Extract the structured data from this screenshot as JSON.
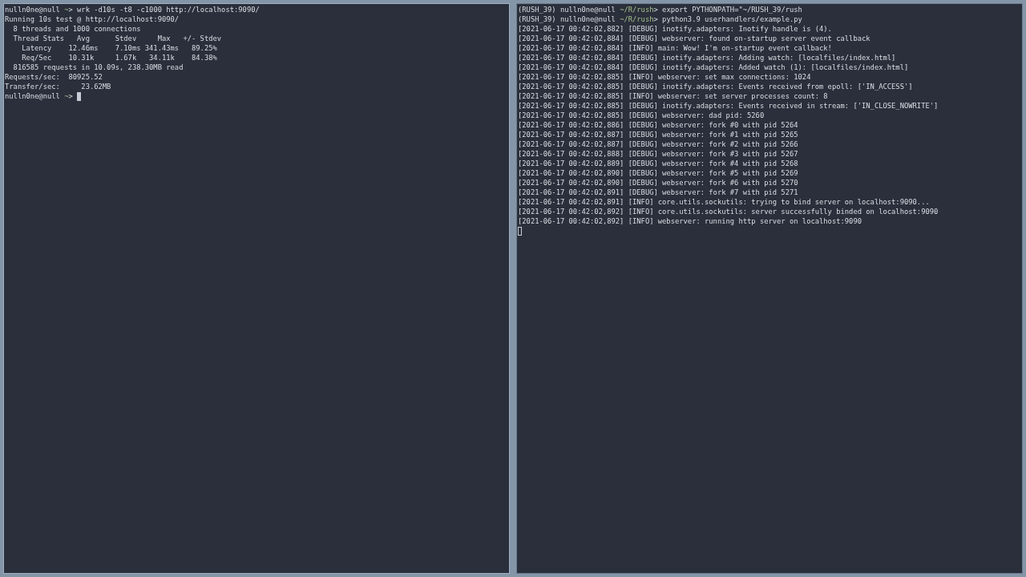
{
  "panes": [
    {
      "focused": true,
      "lines": [
        {
          "kind": "prompt",
          "user": "nulln0ne@null",
          "path": "~",
          "command": "> wrk -d10s -t8 -c1000 http://localhost:9090/"
        },
        {
          "kind": "output",
          "text": "Running 10s test @ http://localhost:9090/"
        },
        {
          "kind": "output",
          "text": "  8 threads and 1000 connections"
        },
        {
          "kind": "output",
          "text": "  Thread Stats   Avg      Stdev     Max   +/- Stdev"
        },
        {
          "kind": "output",
          "text": "    Latency    12.46ms    7.10ms 341.43ms   89.25%"
        },
        {
          "kind": "output",
          "text": "    Req/Sec    10.31k     1.67k   34.11k    84.38%"
        },
        {
          "kind": "output",
          "text": "  816585 requests in 10.09s, 238.30MB read"
        },
        {
          "kind": "output",
          "text": "Requests/sec:  80925.52"
        },
        {
          "kind": "output",
          "text": "Transfer/sec:     23.62MB"
        },
        {
          "kind": "prompt",
          "user": "nulln0ne@null",
          "path": "~",
          "command": "> ",
          "cursor": true
        }
      ]
    },
    {
      "focused": false,
      "lines": [
        {
          "kind": "prompt",
          "env": "(RUSH_39)",
          "user": "nulln0ne@null",
          "path": "~/R/rush",
          "command": "> export PYTHONPATH=\"~/RUSH_39/rush"
        },
        {
          "kind": "prompt",
          "env": "(RUSH_39)",
          "user": "nulln0ne@null",
          "path": "~/R/rush",
          "command": "> python3.9 userhandlers/example.py"
        },
        {
          "kind": "output",
          "text": "[2021-06-17 00:42:02,882] [DEBUG] inotify.adapters: Inotify handle is (4)."
        },
        {
          "kind": "output",
          "text": "[2021-06-17 00:42:02,884] [DEBUG] webserver: found on-startup server event callback"
        },
        {
          "kind": "output",
          "text": "[2021-06-17 00:42:02,884] [INFO] main: Wow! I'm on-startup event callback!"
        },
        {
          "kind": "output",
          "text": "[2021-06-17 00:42:02,884] [DEBUG] inotify.adapters: Adding watch: [localfiles/index.html]"
        },
        {
          "kind": "output",
          "text": "[2021-06-17 00:42:02,884] [DEBUG] inotify.adapters: Added watch (1): [localfiles/index.html]"
        },
        {
          "kind": "output",
          "text": "[2021-06-17 00:42:02,885] [INFO] webserver: set max connections: 1024"
        },
        {
          "kind": "output",
          "text": "[2021-06-17 00:42:02,885] [DEBUG] inotify.adapters: Events received from epoll: ['IN_ACCESS']"
        },
        {
          "kind": "output",
          "text": "[2021-06-17 00:42:02,885] [INFO] webserver: set server processes count: 8"
        },
        {
          "kind": "output",
          "text": "[2021-06-17 00:42:02,885] [DEBUG] inotify.adapters: Events received in stream: ['IN_CLOSE_NOWRITE']"
        },
        {
          "kind": "output",
          "text": "[2021-06-17 00:42:02,885] [DEBUG] webserver: dad pid: 5260"
        },
        {
          "kind": "output",
          "text": "[2021-06-17 00:42:02,886] [DEBUG] webserver: fork #0 with pid 5264"
        },
        {
          "kind": "output",
          "text": "[2021-06-17 00:42:02,887] [DEBUG] webserver: fork #1 with pid 5265"
        },
        {
          "kind": "output",
          "text": "[2021-06-17 00:42:02,887] [DEBUG] webserver: fork #2 with pid 5266"
        },
        {
          "kind": "output",
          "text": "[2021-06-17 00:42:02,888] [DEBUG] webserver: fork #3 with pid 5267"
        },
        {
          "kind": "output",
          "text": "[2021-06-17 00:42:02,889] [DEBUG] webserver: fork #4 with pid 5268"
        },
        {
          "kind": "output",
          "text": "[2021-06-17 00:42:02,890] [DEBUG] webserver: fork #5 with pid 5269"
        },
        {
          "kind": "output",
          "text": "[2021-06-17 00:42:02,890] [DEBUG] webserver: fork #6 with pid 5270"
        },
        {
          "kind": "output",
          "text": "[2021-06-17 00:42:02,891] [DEBUG] webserver: fork #7 with pid 5271"
        },
        {
          "kind": "output",
          "text": "[2021-06-17 00:42:02,891] [INFO] core.utils.sockutils: trying to bind server on localhost:9090..."
        },
        {
          "kind": "output",
          "text": "[2021-06-17 00:42:02,892] [INFO] core.utils.sockutils: server successfully binded on localhost:9090"
        },
        {
          "kind": "output",
          "text": "[2021-06-17 00:42:02,892] [INFO] webserver: running http server on localhost:9090"
        },
        {
          "kind": "cursor"
        }
      ]
    }
  ]
}
